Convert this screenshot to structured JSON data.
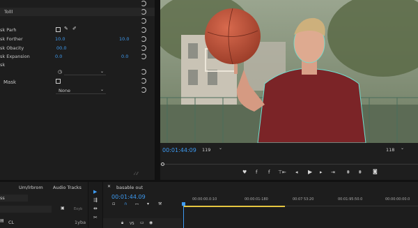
{
  "effect_controls": {
    "section_title": "Tolll",
    "rows": [
      {
        "label": "sk Parh"
      },
      {
        "label": "sk Forther",
        "v1": "10.0",
        "v2": "10.0"
      },
      {
        "label": "sk Obacity",
        "v1": "00.0"
      },
      {
        "label": "sk Expansion",
        "v1": "0.0",
        "v2": "0.0"
      },
      {
        "label": "sk"
      },
      {
        "label": "Mask"
      },
      {
        "label": "",
        "dropdown": "None"
      }
    ],
    "footer_icons": "ᵢ⁄ ⁄⁄"
  },
  "program_monitor": {
    "timecode": "00:01:44:09",
    "zoom": "119",
    "resolution": "118",
    "transport_icons": [
      "marker",
      "in",
      "out",
      "go-in",
      "step-back",
      "play",
      "step-forward",
      "go-out",
      "insert",
      "overwrite",
      "camera"
    ]
  },
  "project_panel": {
    "tabs": [
      "Um/lrbrom",
      "Audio Tracks"
    ],
    "search_value": "ss",
    "item_label": "CL",
    "item_meta": "1yba",
    "small_label": "Eoyb"
  },
  "timeline": {
    "sequence_name": "basable out",
    "timecode": "00:01:44.09",
    "ruler_labels": [
      "00:00:00.0:10",
      "00:00:01-180",
      "00:07 53:20",
      "00:01:95:50.0",
      "00:00:00:00.0"
    ],
    "track_label": "VS"
  },
  "colors": {
    "accent": "#3e9bf2",
    "timeline_bar": "#e6c640",
    "bg": "#1b1b1b"
  }
}
